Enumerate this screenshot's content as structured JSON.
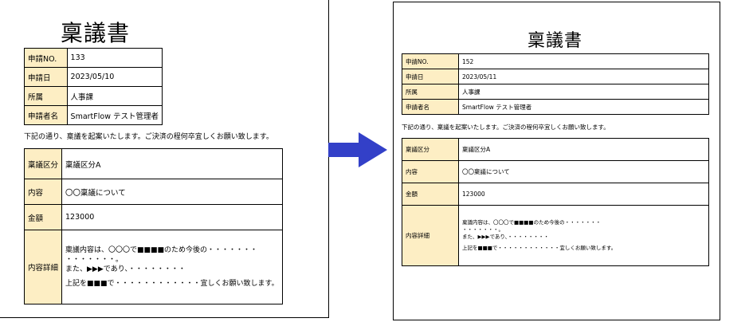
{
  "left": {
    "title": "稟議書",
    "info": [
      {
        "label": "申請NO.",
        "value": "133"
      },
      {
        "label": "申請日",
        "value": "2023/05/10"
      },
      {
        "label": "所属",
        "value": "人事課"
      },
      {
        "label": "申請者名",
        "value": "SmartFlow テスト管理者"
      }
    ],
    "intro": "下記の通り、稟議を起案いたします。ご決済の程何卒宜しくお願い致します。",
    "details": [
      {
        "label": "稟議区分",
        "value": "稟議区分A"
      },
      {
        "label": "内容",
        "value": "〇〇稟議について"
      },
      {
        "label": "金額",
        "value": "123000"
      },
      {
        "label": "内容詳細",
        "lines": [
          "稟議内容は、〇〇〇で■■■■のため今後の・・・・・・・",
          "・・・・・・・。",
          "また、▶▶▶であり、・・・・・・・・",
          "上記を■■■で・・・・・・・・・・・・宜しくお願い致します。"
        ]
      }
    ]
  },
  "right": {
    "title": "稟議書",
    "info": [
      {
        "label": "申請NO.",
        "value": "152"
      },
      {
        "label": "申請日",
        "value": "2023/05/11"
      },
      {
        "label": "所属",
        "value": "人事課"
      },
      {
        "label": "申請者名",
        "value": "SmartFlow テスト管理者"
      }
    ],
    "intro": "下記の通り、稟議を起案いたします。ご決済の程何卒宜しくお願い致します。",
    "details": [
      {
        "label": "稟議区分",
        "value": "稟議区分A"
      },
      {
        "label": "内容",
        "value": "〇〇稟議について"
      },
      {
        "label": "金額",
        "value": "123000"
      },
      {
        "label": "内容詳細",
        "lines": [
          "稟議内容は、〇〇〇で■■■■のため今後の・・・・・・・",
          "・・・・・・・。",
          "また、▶▶▶であり、・・・・・・・・",
          "上記を■■■で・・・・・・・・・・・・宜しくお願い致します。"
        ]
      }
    ]
  },
  "colors": {
    "label_bg": "#fdeec4",
    "arrow": "#3340c8"
  },
  "icons": {
    "transition": "arrow-right-icon"
  }
}
